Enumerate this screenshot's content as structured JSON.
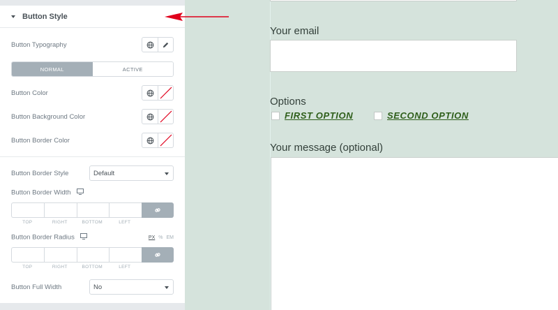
{
  "panel": {
    "section_title": "Button Style",
    "typography_label": "Button Typography",
    "tabs": [
      {
        "label": "NORMAL",
        "active": true
      },
      {
        "label": "ACTIVE",
        "active": false
      }
    ],
    "color_label": "Button Color",
    "bg_color_label": "Button Background Color",
    "border_color_label": "Button Border Color",
    "border_style_label": "Button Border Style",
    "border_style_value": "Default",
    "border_width_label": "Button Border Width",
    "border_radius_label": "Button Border Radius",
    "dimension_labels": [
      "TOP",
      "RIGHT",
      "BOTTOM",
      "LEFT"
    ],
    "units": [
      "PX",
      "%",
      "EM"
    ],
    "active_unit": "PX",
    "full_width_label": "Button Full Width",
    "full_width_value": "No",
    "icons": {
      "collapse": "caret-down-icon",
      "global": "globe-icon",
      "edit": "pencil-icon",
      "color_clear": "color-swatch-none-icon",
      "responsive": "desktop-icon",
      "link": "link-icon",
      "panel_toggle": "chevron-left-icon"
    }
  },
  "preview": {
    "email_label": "Your email",
    "options_label": "Options",
    "options": [
      "FIRST OPTION",
      "SECOND OPTION"
    ],
    "message_label": "Your message (optional)",
    "background_color": "#d5e3dc",
    "option_color": "#2e5e1a"
  },
  "annotation": {
    "arrow_color": "#e0001b"
  },
  "colors": {
    "panel_bg": "#e6e9ec",
    "tab_active": "#a4afb7",
    "label": "#6d7882"
  }
}
